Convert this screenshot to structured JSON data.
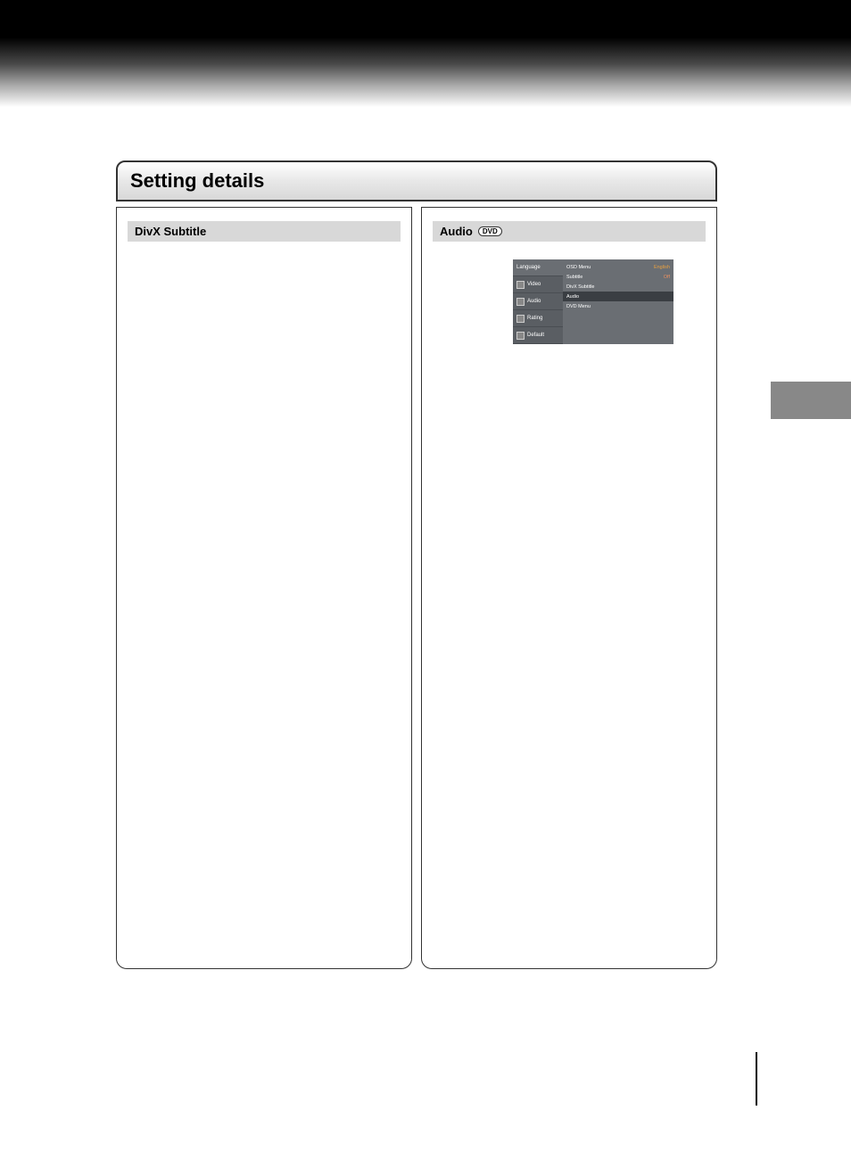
{
  "section_title": "Setting details",
  "left_column": {
    "header": "DivX Subtitle"
  },
  "right_column": {
    "header": "Audio",
    "badge": "DVD"
  },
  "menu": {
    "tabs": [
      {
        "label": "Language"
      },
      {
        "label": "Video"
      },
      {
        "label": "Audio"
      },
      {
        "label": "Rating"
      },
      {
        "label": "Default"
      }
    ],
    "items": [
      {
        "label": "OSD Menu",
        "value": "English"
      },
      {
        "label": "Subtitle",
        "value": "Off"
      },
      {
        "label": "DivX Subtitle",
        "value": ""
      },
      {
        "label": "Audio",
        "value": ""
      },
      {
        "label": "DVD Menu",
        "value": ""
      }
    ]
  }
}
